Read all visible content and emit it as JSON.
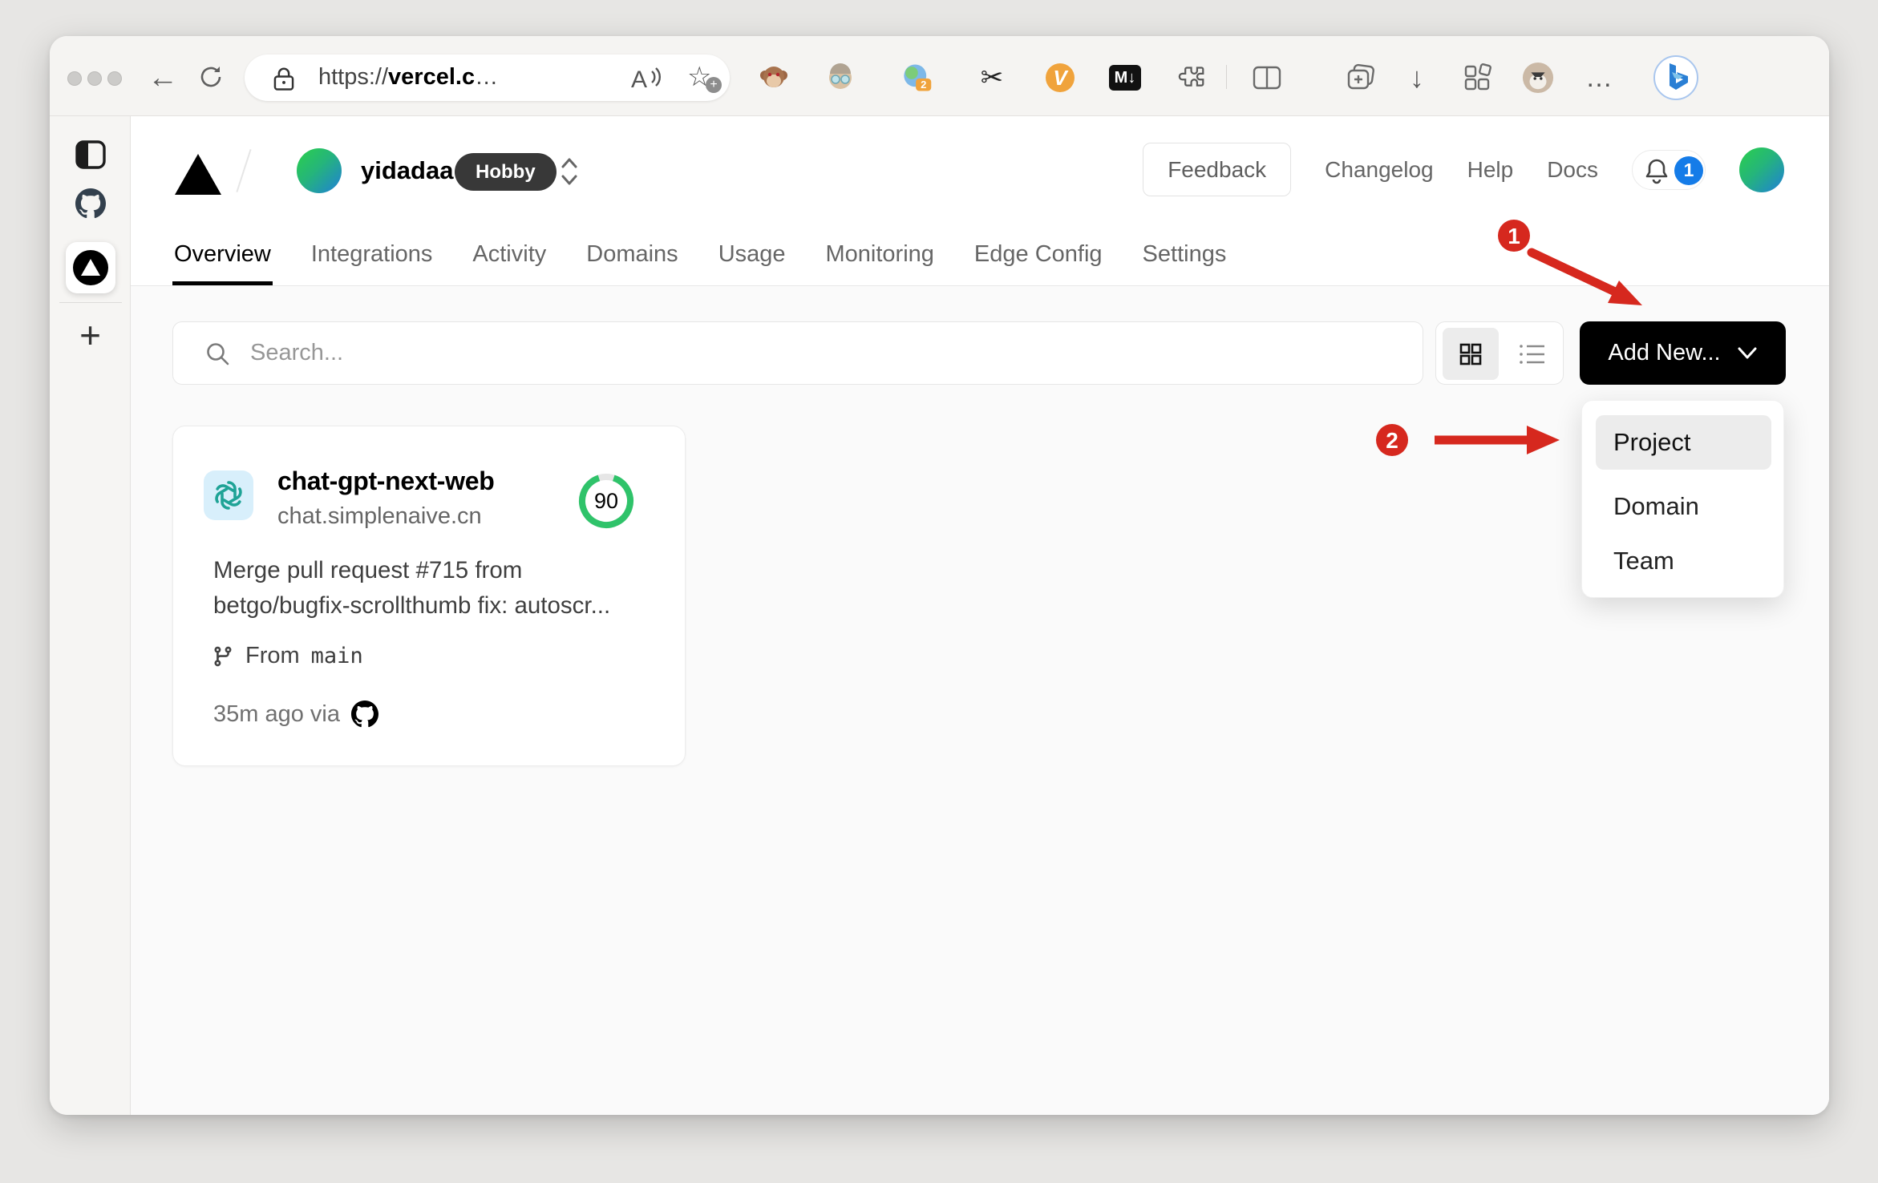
{
  "browser": {
    "url": {
      "scheme": "https://",
      "domain": "vercel.c",
      "ellipsis": "…"
    },
    "back_glyph": "←",
    "extension_badge": "2",
    "md_icon_label": "M↓",
    "v_icon_label": "V",
    "more_glyph": "…",
    "download_glyph": "↓",
    "star_glyph": "☆",
    "scissors_glyph": "✂"
  },
  "sidebar_plus_glyph": "+",
  "vercel": {
    "team": {
      "name": "yidadaa",
      "plan": "Hobby"
    },
    "nav": {
      "feedback": "Feedback",
      "changelog": "Changelog",
      "help": "Help",
      "docs": "Docs",
      "notification_count": "1"
    },
    "tabs": [
      {
        "label": "Overview"
      },
      {
        "label": "Integrations"
      },
      {
        "label": "Activity"
      },
      {
        "label": "Domains"
      },
      {
        "label": "Usage"
      },
      {
        "label": "Monitoring"
      },
      {
        "label": "Edge Config"
      },
      {
        "label": "Settings"
      }
    ],
    "controls": {
      "search_placeholder": "Search...",
      "add_new": "Add New..."
    },
    "project": {
      "name": "chat-gpt-next-web",
      "domain": "chat.simplenaive.cn",
      "score": "90",
      "commit": "Merge pull request #715 from betgo/bugfix-scrollthumb fix: autoscr...",
      "from_label": "From",
      "branch": "main",
      "deployed": "35m ago via"
    },
    "dropdown": {
      "items": [
        {
          "label": "Project"
        },
        {
          "label": "Domain"
        },
        {
          "label": "Team"
        }
      ]
    }
  },
  "annotations": {
    "step1": "1",
    "step2": "2"
  },
  "colors": {
    "annotation_red": "#d6281e",
    "badge_blue": "#157ce8",
    "ring_green": "#2fc36a",
    "brand_black": "#000000"
  }
}
